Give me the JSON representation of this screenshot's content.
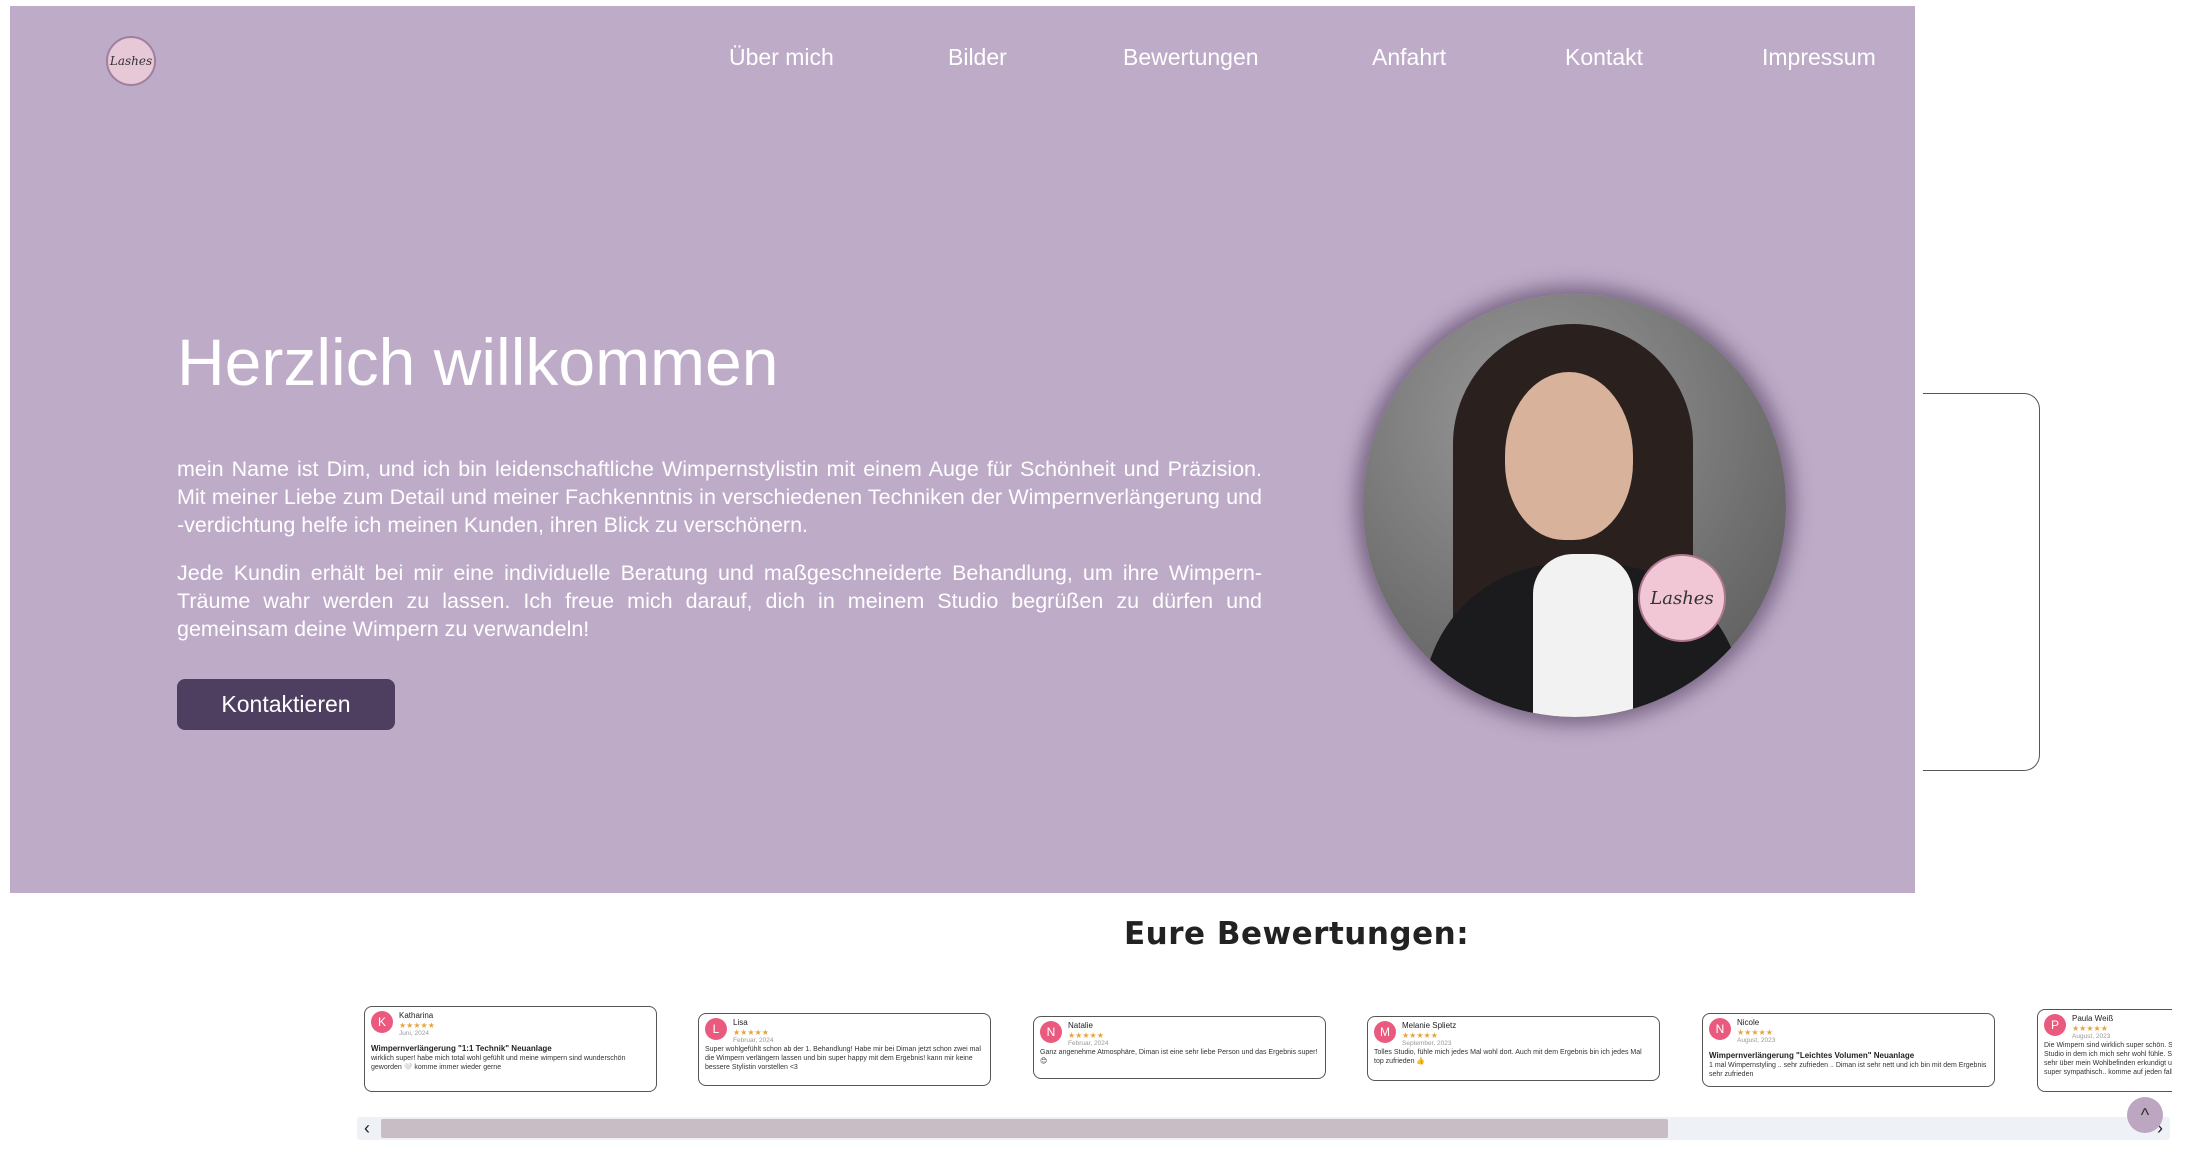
{
  "brand": {
    "logo_text": "Lashes"
  },
  "nav": {
    "items": [
      {
        "label": "Über mich"
      },
      {
        "label": "Bilder"
      },
      {
        "label": "Bewertungen"
      },
      {
        "label": "Anfahrt"
      },
      {
        "label": "Kontakt"
      },
      {
        "label": "Impressum"
      }
    ]
  },
  "hero": {
    "title": "Herzlich willkommen",
    "paragraph_1": "mein Name ist Dim, und ich bin leidenschaftliche Wimpernstylistin mit einem Auge für Schönheit und Präzision. Mit meiner Liebe zum Detail und meiner Fachkenntnis in verschiedenen Techniken der Wimpernverlängerung und -verdichtung helfe ich meinen Kunden, ihren Blick zu verschönern.",
    "paragraph_2": "Jede Kundin erhält bei mir eine individuelle Beratung und maßgeschneiderte Behandlung, um ihre Wimpern-Träume wahr werden zu lassen. Ich freue mich darauf, dich in meinem Studio begrüßen zu dürfen und gemeinsam deine Wimpern zu verwandeln!",
    "cta_label": "Kontaktieren",
    "portrait_badge": "Lashes"
  },
  "reviews": {
    "title": "Eure Bewertungen:",
    "items": [
      {
        "initial": "K",
        "name": "Katharina",
        "stars": "★★★★★",
        "date": "Juni, 2024",
        "headline": "Wimpernverlängerung \"1:1 Technik\" Neuanlage",
        "text": "wirklich super! habe mich total wohl gefühlt und meine wimpern sind wunderschön geworden 🤍 komme immer wieder gerne"
      },
      {
        "initial": "L",
        "name": "Lisa",
        "stars": "★★★★★",
        "date": "Februar, 2024",
        "headline": "",
        "text": "Super wohlgefühlt schon ab der 1. Behandlung! Habe mir bei Diman jetzt schon zwei mal die Wimpern verlängern lassen und bin super happy mit dem Ergebnis! kann mir keine bessere Stylistin vorstellen <3"
      },
      {
        "initial": "N",
        "name": "Natalie",
        "stars": "★★★★★",
        "date": "Februar, 2024",
        "headline": "",
        "text": "Ganz angenehme Atmosphäre, Diman ist eine sehr liebe Person und das Ergebnis super! 😊"
      },
      {
        "initial": "M",
        "name": "Melanie Splietz",
        "stars": "★★★★★",
        "date": "September, 2023",
        "headline": "",
        "text": "Tolles Studio, fühle mich jedes Mal wohl dort. Auch mit dem Ergebnis bin ich jedes Mal top zufrieden 👍"
      },
      {
        "initial": "N",
        "name": "Nicole",
        "stars": "★★★★★",
        "date": "August, 2023",
        "headline": "Wimpernverlängerung \"Leichtes Volumen\" Neuanlage",
        "text": "1 mal Wimpernstyling .. sehr zufrieden .. Diman ist sehr nett und ich bin mit dem Ergebnis sehr zufrieden"
      },
      {
        "initial": "P",
        "name": "Paula Weiß",
        "stars": "★★★★★",
        "date": "August, 2023",
        "headline": "",
        "text": "Die Wimpern sind wirklich super schön. Sauberes Studio in dem ich mich sehr wohl fühle. Sie achtet sehr über mein Wohlbefinden erkundigt und ist super sympathisch.. komme auf jeden fall wieder!"
      }
    ]
  },
  "scrollbar": {
    "left_arrow": "‹",
    "right_arrow": "›",
    "position_fraction": 0.0,
    "visible_fraction": 0.71
  },
  "scroll_top": {
    "icon": "^"
  }
}
